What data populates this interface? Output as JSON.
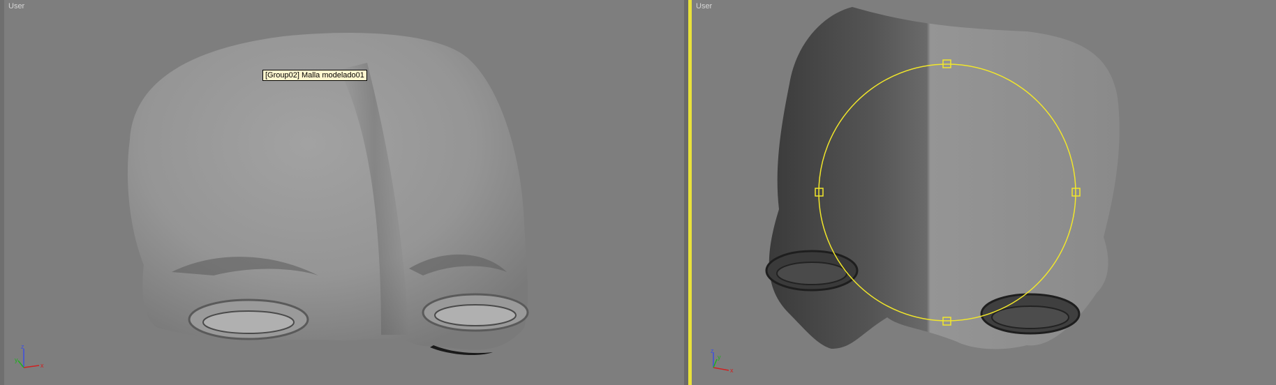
{
  "viewports": {
    "left": {
      "label": "User"
    },
    "right": {
      "label": "User"
    }
  },
  "tooltip": {
    "text": "[Group02] Malla modelado01"
  },
  "axis": {
    "z": "z",
    "y": "y",
    "x": "x"
  },
  "colors": {
    "background": "#7e7e7e",
    "active_border": "#e9e23a",
    "gizmo": "#f2e72a",
    "axis_x": "#d02020",
    "axis_y": "#1fb01f",
    "axis_z": "#3d4ee0"
  }
}
